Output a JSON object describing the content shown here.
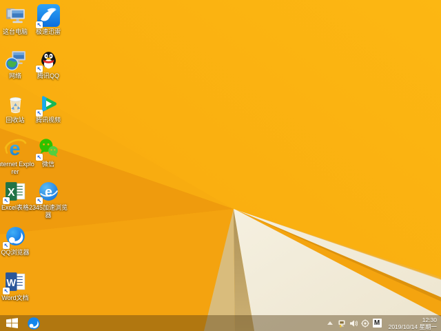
{
  "wallpaper": {
    "base_orange": "#FBB313",
    "dark_wedge": "#EF9B0D",
    "cream": "#F2ECDA",
    "tan": "#BFA263",
    "ribbon": "#F4A40F"
  },
  "desktop": {
    "icons": [
      {
        "id": "this-pc",
        "label": "这台电脑",
        "shortcut": false
      },
      {
        "id": "xunlei",
        "label": "极速迅雷",
        "shortcut": true
      },
      {
        "id": "network",
        "label": "网络",
        "shortcut": false
      },
      {
        "id": "tencent-qq",
        "label": "腾讯QQ",
        "shortcut": true
      },
      {
        "id": "recycle-bin",
        "label": "回收站",
        "shortcut": false
      },
      {
        "id": "tencent-video",
        "label": "腾讯视频",
        "shortcut": true
      },
      {
        "id": "internet-explorer",
        "label": "Internet Explorer",
        "shortcut": false
      },
      {
        "id": "wechat",
        "label": "微信",
        "shortcut": true
      },
      {
        "id": "excel",
        "label": "Excel表格",
        "shortcut": true
      },
      {
        "id": "browser-2345",
        "label": "2345加速浏览器",
        "shortcut": true
      },
      {
        "id": "qq-browser",
        "label": "QQ浏览器",
        "shortcut": true
      },
      {
        "id": "word",
        "label": "Word文档",
        "shortcut": true
      }
    ]
  },
  "taskbar": {
    "pinned_icons": [
      "qq-browser"
    ],
    "tray": {
      "icons": [
        "hidden-icons-chevron",
        "network-warning",
        "volume",
        "safety-center",
        "ime"
      ],
      "ime_badge": "M",
      "time": "12:30",
      "date": "2019/10/14 星期一"
    }
  }
}
